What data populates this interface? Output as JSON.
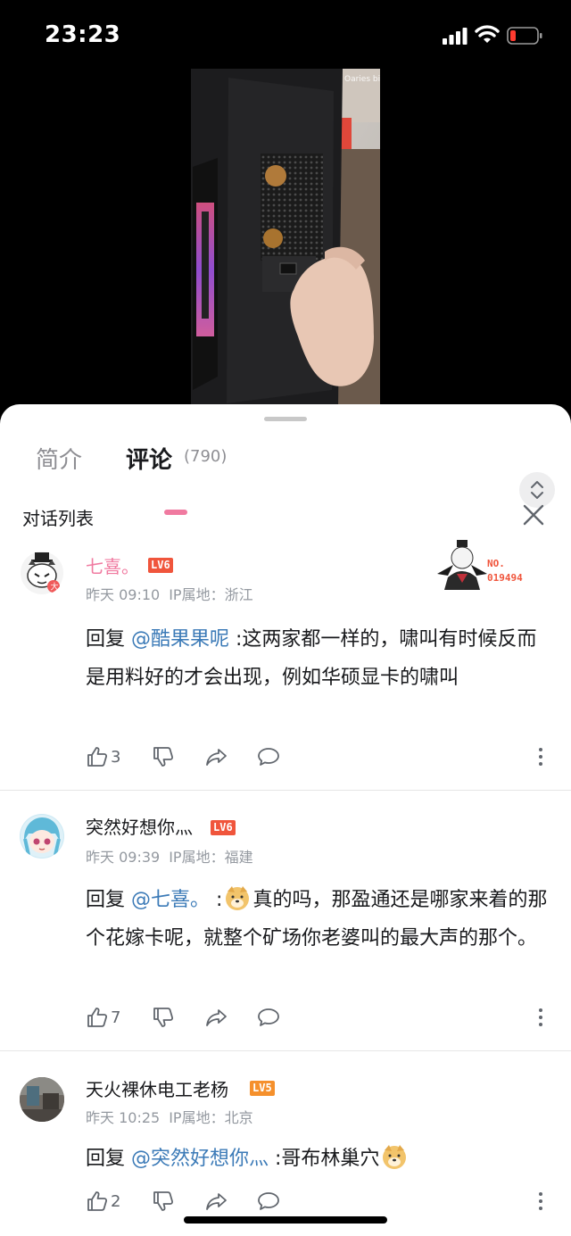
{
  "status": {
    "time": "23:23"
  },
  "video": {
    "watermark": "Oaries bilibili"
  },
  "tabs": {
    "intro": "简介",
    "comments": "评论",
    "comment_count": "(790)"
  },
  "dialog": {
    "title": "对话列表"
  },
  "comments": [
    {
      "username": "七喜。",
      "username_color": "#f07aa0",
      "level": "LV6",
      "level_color": "#f0553c",
      "time": "昨天 09:10",
      "ip": "IP属地：浙江",
      "reply_prefix": "回复",
      "mention": "@酷果果呢",
      "text": " :这两家都一样的，啸叫有时候反而是用料好的才会出现，例如华硕显卡的啸叫",
      "likes": "3",
      "badge_no": "NO.",
      "badge_num": "019494"
    },
    {
      "username": "突然好想你灬",
      "username_color": "#18191c",
      "level": "LV6",
      "level_color": "#f0553c",
      "time": "昨天 09:39",
      "ip": "IP属地：福建",
      "reply_prefix": "回复",
      "mention": "@七喜。",
      "text_before": " :",
      "text": "真的吗，那盈通还是哪家来着的那个花嫁卡呢，就整个矿场你老婆叫的最大声的那个。",
      "likes": "7"
    },
    {
      "username": "天火裸休电工老杨",
      "username_color": "#18191c",
      "level": "LV5",
      "level_color": "#f5902c",
      "time": "昨天 10:25",
      "ip": "IP属地：北京",
      "reply_prefix": "回复",
      "mention": "@突然好想你灬",
      "text": " :哥布林巢穴",
      "likes": "2"
    }
  ],
  "icons": {
    "like": "thumbs-up-icon",
    "dislike": "thumbs-down-icon",
    "share": "share-icon",
    "reply": "comment-icon",
    "more": "more-vertical-icon",
    "emoji": "doge-emoji-icon"
  }
}
